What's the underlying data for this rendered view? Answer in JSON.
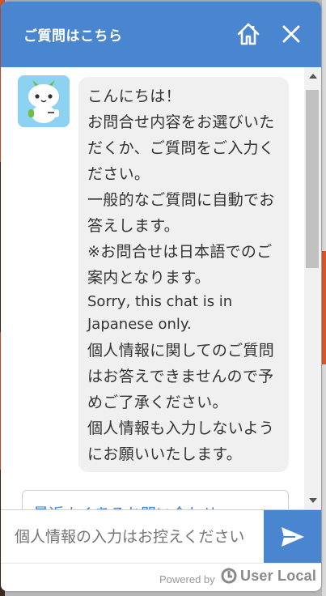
{
  "header": {
    "title": "ご質問はこちら",
    "home_icon": "home-icon",
    "close_icon": "close-icon",
    "color": "#4a86cf"
  },
  "bot": {
    "avatar_icon": "robot-avatar-icon"
  },
  "message": {
    "lines": [
      "こんにちは！",
      "お問合せ内容をお選びいただくか、ご質問をご入力ください。",
      "一般的なご質問に自動でお答えします。",
      "※お問合せは日本語でのご案内となります。",
      "Sorry, this chat is in Japanese only.",
      "個人情報に関してのご質問はお答えできませんので予めご了承ください。",
      "個人情報も入力しないようにお願いいたします。"
    ]
  },
  "faq": {
    "label": "最近よくあるお問い合わせ"
  },
  "input": {
    "placeholder": "個人情報の入力はお控えください"
  },
  "send": {
    "icon": "send-icon"
  },
  "footer": {
    "powered_by": "Powered by",
    "brand": "User Local"
  }
}
